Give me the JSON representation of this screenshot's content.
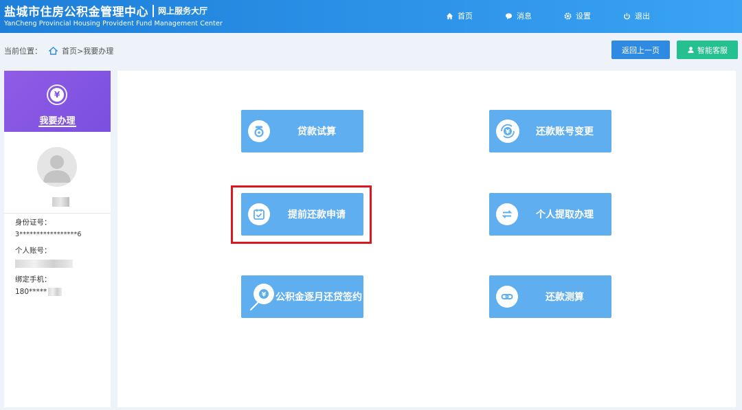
{
  "header": {
    "org_name": "盐城市住房公积金管理中心",
    "service_hall": "网上服务大厅",
    "org_name_en": "YanCheng Provincial Housing Provident Fund Management Center",
    "nav": [
      {
        "label": "首页",
        "icon": "home-icon"
      },
      {
        "label": "消息",
        "icon": "message-icon"
      },
      {
        "label": "设置",
        "icon": "gear-icon"
      },
      {
        "label": "退出",
        "icon": "power-icon"
      }
    ]
  },
  "breadcrumb": {
    "prefix": "当前位置：",
    "home": "首页",
    "current": ">我要办理"
  },
  "actions": {
    "back_label": "返回上一页",
    "service_label": "智能客服"
  },
  "sidebar": {
    "title": "我要办理",
    "id_label": "身份证号：",
    "id_value": "3*****************6",
    "account_label": "个人账号：",
    "phone_label": "绑定手机：",
    "phone_value": "180*****"
  },
  "tiles": [
    {
      "label": "贷款试算",
      "icon": "calculator-coin-icon"
    },
    {
      "label": "还款账号变更",
      "icon": "yen-refresh-icon"
    },
    {
      "label": "提前还款申请",
      "icon": "calendar-check-icon"
    },
    {
      "label": "个人提取办理",
      "icon": "transfer-arrows-icon"
    },
    {
      "label": "公积金逐月还贷签约",
      "icon": "search-yen-icon"
    },
    {
      "label": "还款测算",
      "icon": "link-icon"
    }
  ],
  "colors": {
    "header": "#2a8fe6",
    "tile": "#5eaef0",
    "back_button": "#2f8be2",
    "service_button": "#25c08f",
    "sidebar_head": "#8456e3",
    "highlight": "#d9171e"
  }
}
